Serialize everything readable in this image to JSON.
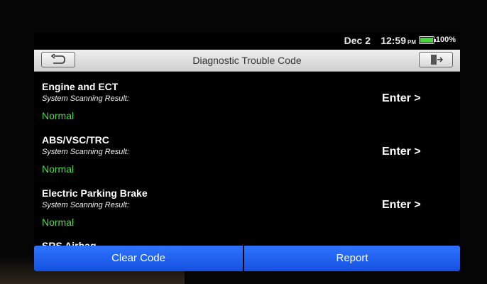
{
  "status": {
    "date": "Dec 2",
    "time": "12:59",
    "ampm": "PM",
    "battery_percent": "100%",
    "battery_level": 1.0
  },
  "header": {
    "title": "Diagnostic Trouble Code",
    "back_icon": "back-arrow-icon",
    "exit_icon": "exit-door-icon"
  },
  "systems": [
    {
      "name": "Engine and ECT",
      "label": "System Scanning Result:",
      "result": "Normal",
      "action": "Enter >"
    },
    {
      "name": "ABS/VSC/TRC",
      "label": "System Scanning Result:",
      "result": "Normal",
      "action": "Enter >"
    },
    {
      "name": "Electric Parking Brake",
      "label": "System Scanning Result:",
      "result": "Normal",
      "action": "Enter >"
    }
  ],
  "partial_next_system": "SRS Airbag",
  "buttons": {
    "clear": "Clear Code",
    "report": "Report"
  },
  "colors": {
    "accent_blue": "#1f5ef0",
    "normal_green": "#4ddc4d",
    "battery_green": "#4cd43c"
  }
}
